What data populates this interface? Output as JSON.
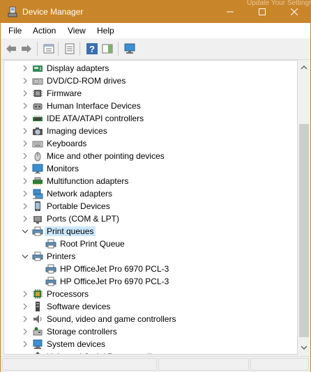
{
  "window": {
    "title": "Device Manager",
    "background_ghost_text": "Update Your Settings",
    "accent_color": "#c9852a"
  },
  "menu": [
    "File",
    "Action",
    "View",
    "Help"
  ],
  "toolbar": {
    "buttons": [
      "back-arrow-icon",
      "forward-arrow-icon",
      "properties-icon",
      "update-driver-icon",
      "help-icon",
      "action-pane-icon",
      "scan-hardware-icon"
    ]
  },
  "tree": {
    "items": [
      {
        "label": "Display adapters",
        "icon": "display-adapter-icon",
        "state": "collapsed"
      },
      {
        "label": "DVD/CD-ROM drives",
        "icon": "dvd-drive-icon",
        "state": "collapsed"
      },
      {
        "label": "Firmware",
        "icon": "firmware-icon",
        "state": "collapsed"
      },
      {
        "label": "Human Interface Devices",
        "icon": "hid-icon",
        "state": "collapsed"
      },
      {
        "label": "IDE ATA/ATAPI controllers",
        "icon": "ide-controller-icon",
        "state": "collapsed"
      },
      {
        "label": "Imaging devices",
        "icon": "camera-icon",
        "state": "collapsed"
      },
      {
        "label": "Keyboards",
        "icon": "keyboard-icon",
        "state": "collapsed"
      },
      {
        "label": "Mice and other pointing devices",
        "icon": "mouse-icon",
        "state": "collapsed"
      },
      {
        "label": "Monitors",
        "icon": "monitor-icon",
        "state": "collapsed"
      },
      {
        "label": "Multifunction adapters",
        "icon": "multifunction-icon",
        "state": "collapsed"
      },
      {
        "label": "Network adapters",
        "icon": "network-adapter-icon",
        "state": "collapsed"
      },
      {
        "label": "Portable Devices",
        "icon": "portable-device-icon",
        "state": "collapsed"
      },
      {
        "label": "Ports (COM & LPT)",
        "icon": "port-icon",
        "state": "collapsed"
      },
      {
        "label": "Print queues",
        "icon": "printer-icon",
        "state": "expanded",
        "selected": true
      },
      {
        "label": "Root Print Queue",
        "icon": "printer-icon",
        "state": "child"
      },
      {
        "label": "Printers",
        "icon": "printer-icon",
        "state": "expanded"
      },
      {
        "label": "HP OfficeJet Pro 6970 PCL-3",
        "icon": "printer-icon",
        "state": "child"
      },
      {
        "label": "HP OfficeJet Pro 6970 PCL-3",
        "icon": "printer-icon",
        "state": "child"
      },
      {
        "label": "Processors",
        "icon": "processor-icon",
        "state": "collapsed"
      },
      {
        "label": "Software devices",
        "icon": "software-device-icon",
        "state": "collapsed"
      },
      {
        "label": "Sound, video and game controllers",
        "icon": "speaker-icon",
        "state": "collapsed"
      },
      {
        "label": "Storage controllers",
        "icon": "storage-controller-icon",
        "state": "collapsed"
      },
      {
        "label": "System devices",
        "icon": "system-device-icon",
        "state": "collapsed"
      },
      {
        "label": "Universal Serial Bus controllers",
        "icon": "usb-icon",
        "state": "collapsed",
        "partially_visible": true
      }
    ]
  },
  "statusbar": {
    "text": ""
  }
}
